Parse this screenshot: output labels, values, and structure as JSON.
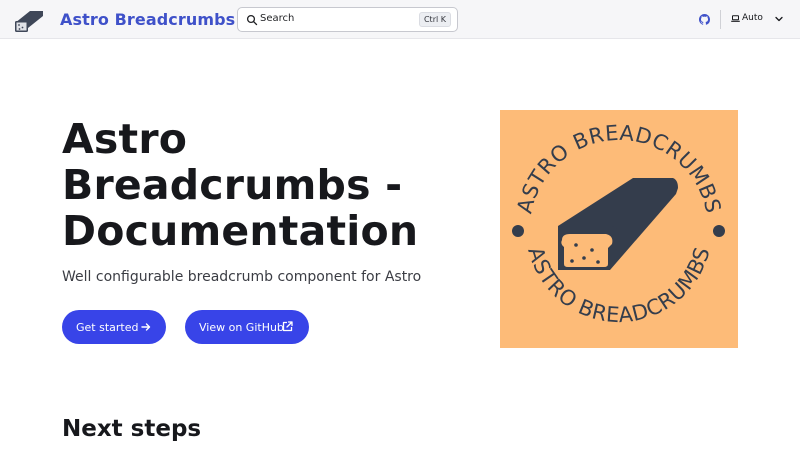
{
  "header": {
    "site_title": "Astro Breadcrumbs",
    "search": {
      "placeholder": "Search",
      "shortcut": "Ctrl K"
    },
    "theme": {
      "selected": "Auto"
    }
  },
  "hero": {
    "title": "Astro Breadcrumbs - Documentation",
    "tagline": "Well configurable breadcrumb component for Astro",
    "actions": [
      {
        "label": "Get started"
      },
      {
        "label": "View on GitHub"
      }
    ],
    "image": {
      "text": "ASTRO BREADCRUMBS"
    }
  },
  "content": {
    "next_steps_heading": "Next steps"
  },
  "colors": {
    "brand": "#3f51c9",
    "button": "#3844e8",
    "logo_bg": "#fdbb78",
    "logo_ink": "#343d4c"
  }
}
